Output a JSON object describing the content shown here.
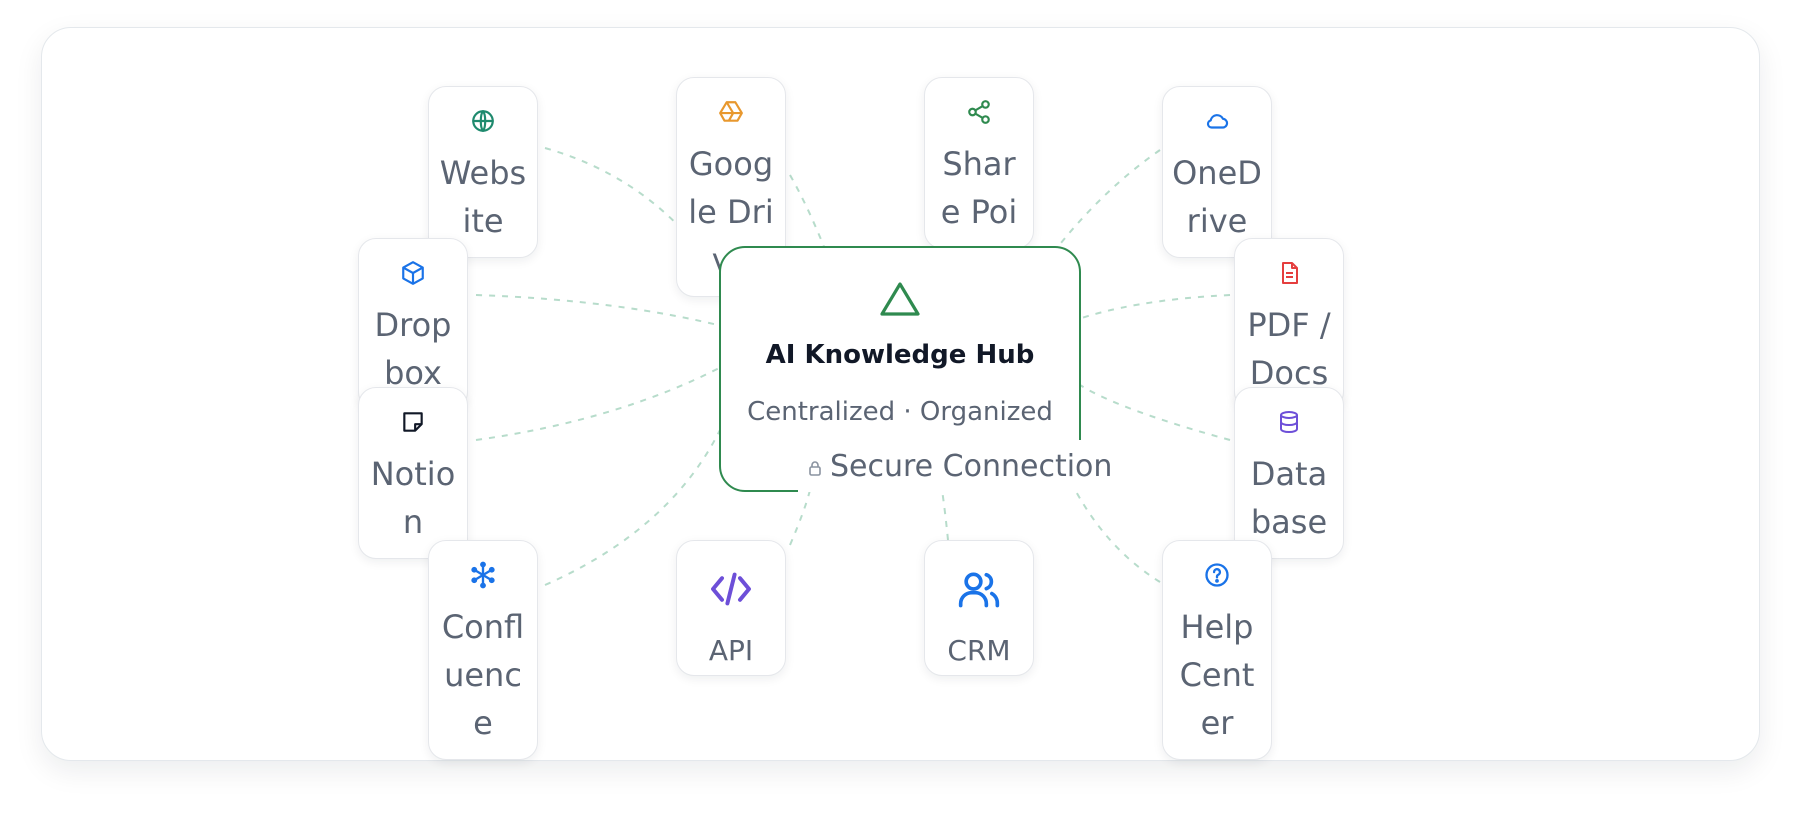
{
  "hub": {
    "title": "AI Knowledge Hub",
    "subtitle": "Centralized · Organized · Smart",
    "badge": "Secure Connection"
  },
  "nodes": [
    {
      "id": "website",
      "label": "Website",
      "icon": "globe-icon"
    },
    {
      "id": "google-drive",
      "label": "Google Drive",
      "icon": "google-drive-icon"
    },
    {
      "id": "sharepoint",
      "label": "Share Point",
      "icon": "share-icon"
    },
    {
      "id": "onedrive",
      "label": "OneDrive",
      "icon": "cloud-icon"
    },
    {
      "id": "dropbox",
      "label": "Dropbox",
      "icon": "box-icon"
    },
    {
      "id": "pdf-docs",
      "label": "PDF / Docs",
      "icon": "document-icon"
    },
    {
      "id": "notion",
      "label": "Notion",
      "icon": "sticky-note-icon"
    },
    {
      "id": "databases",
      "label": "Databases",
      "icon": "database-icon"
    },
    {
      "id": "confluence",
      "label": "Confluence",
      "icon": "confluence-icon"
    },
    {
      "id": "api",
      "label": "API",
      "icon": "code-icon"
    },
    {
      "id": "crm",
      "label": "CRM",
      "icon": "users-icon"
    },
    {
      "id": "help-center",
      "label": "Help Center",
      "icon": "help-circle-icon"
    }
  ],
  "colors": {
    "hub_border": "#2f8a4f",
    "connector": "#b7dccb",
    "website_icon": "#1f8a6e",
    "google_drive_icon": "#e8982e",
    "sharepoint_icon": "#2f8a4f",
    "onedrive_icon": "#1a73e8",
    "dropbox_icon": "#1a73e8",
    "pdf_icon": "#e53e3e",
    "notion_icon": "#111827",
    "databases_icon": "#6d4fd8",
    "confluence_icon": "#1a73e8",
    "api_icon": "#6d4fd8",
    "crm_icon": "#1a73e8",
    "help_icon": "#1a73e8"
  }
}
